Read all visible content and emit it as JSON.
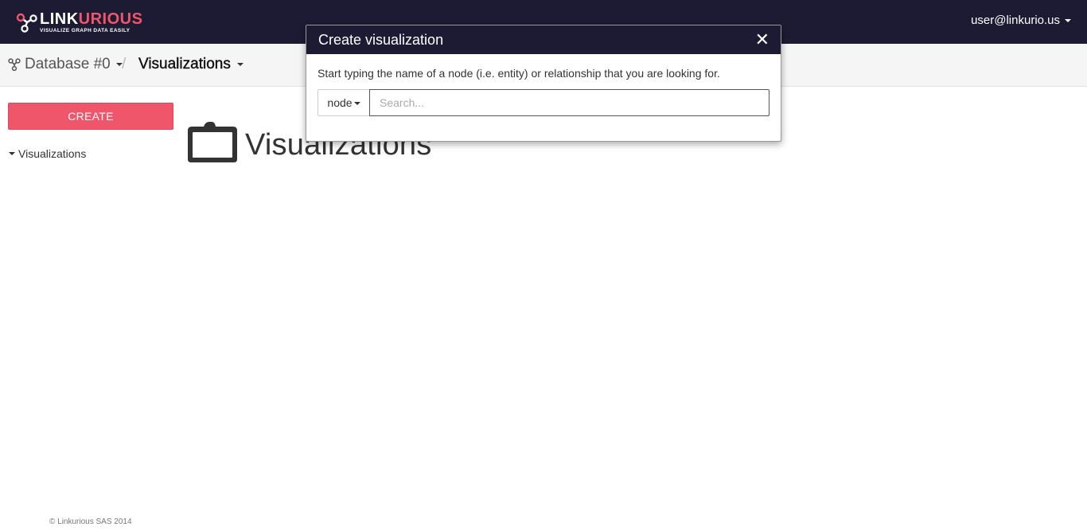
{
  "app": {
    "brand_part1": "LINK",
    "brand_part2": "URIOUS",
    "tagline": "VISUALIZE GRAPH DATA EASILY",
    "accent_color": "#f0566a",
    "nav_color": "#1c1b33"
  },
  "header": {
    "user": "user@linkurio.us"
  },
  "breadcrumb": {
    "database": "Database #0",
    "separator": "/",
    "section": "Visualizations"
  },
  "sidebar": {
    "create_label": "CREATE",
    "tree_item": "Visualizations"
  },
  "main": {
    "title": "Visualizations",
    "title_icon": "folder-icon"
  },
  "footer": {
    "copyright": "© Linkurious SAS 2014"
  },
  "modal": {
    "title": "Create visualization",
    "close_glyph": "✕",
    "description": "Start typing the name of a node (i.e. entity) or relationship that you are looking for.",
    "type_selected": "node",
    "search_placeholder": "Search...",
    "search_value": ""
  }
}
